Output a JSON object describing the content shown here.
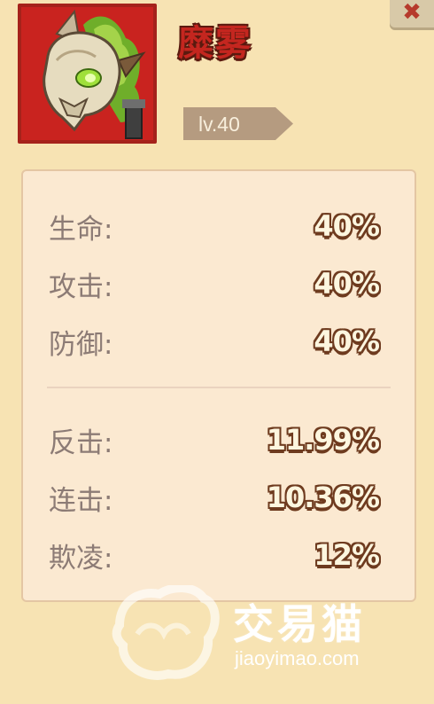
{
  "close": {
    "glyph": "✖"
  },
  "hero": {
    "name": "糜雾",
    "level": "lv.40",
    "portrait_icon": "skull-dragon-icon"
  },
  "stats": [
    {
      "label": "生命:",
      "value": "40%"
    },
    {
      "label": "攻击:",
      "value": "40%"
    },
    {
      "label": "防御:",
      "value": "40%"
    },
    {
      "label": "反击:",
      "value": "11.99%"
    },
    {
      "label": "连击:",
      "value": "10.36%"
    },
    {
      "label": "欺凌:",
      "value": "12%"
    }
  ],
  "watermark": {
    "brand": "交易猫",
    "url": "jiaoyimao.com"
  },
  "colors": {
    "background": "#f7e3b3",
    "name_red": "#c4261f",
    "panel": "#fbe9d1",
    "value_outline": "#6e3b1f"
  }
}
